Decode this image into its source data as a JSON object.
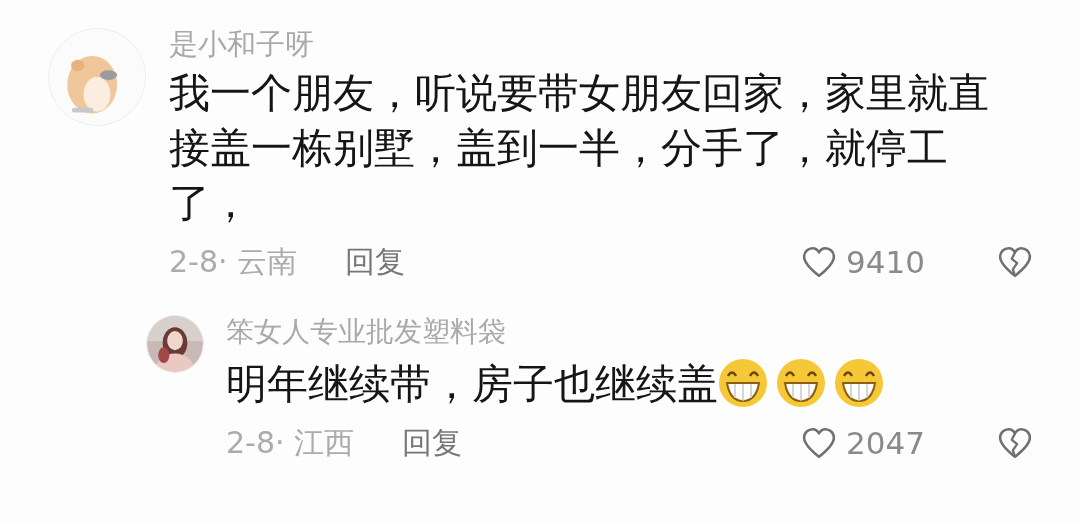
{
  "comments": [
    {
      "username": "是小和子呀",
      "text": "我一个朋友，听说要带女朋友回家，家里就直接盖一栋别墅，盖到一半，分手了，就停工了，",
      "date_location": "2-8· 云南",
      "reply_label": "回复",
      "likes": "9410",
      "replies": [
        {
          "username": "笨女人专业批发塑料袋",
          "text": "明年继续带，房子也继续盖",
          "emojis": [
            {
              "kind": "grin"
            },
            {
              "kind": "grin"
            },
            {
              "kind": "grin"
            }
          ],
          "date_location": "2-8· 江西",
          "reply_label": "回复",
          "likes": "2047"
        }
      ]
    }
  ]
}
